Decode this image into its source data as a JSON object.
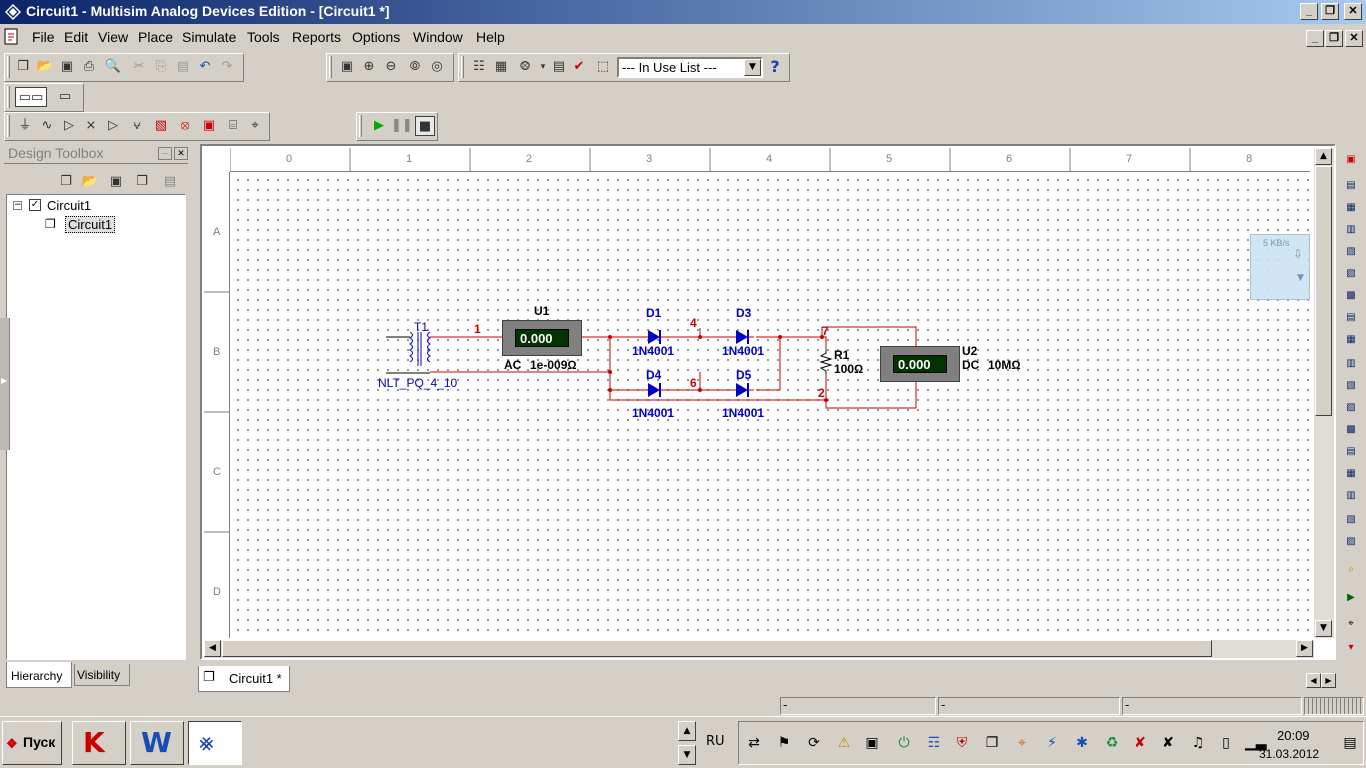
{
  "window": {
    "title": "Circuit1 - Multisim Analog Devices Edition - [Circuit1 *]"
  },
  "menu": [
    "File",
    "Edit",
    "View",
    "Place",
    "Simulate",
    "Tools",
    "Reports",
    "Options",
    "Window",
    "Help"
  ],
  "toolbar": {
    "in_use_list": "--- In Use List ---",
    "help_icon": "?"
  },
  "toolbox": {
    "title": "Design Toolbox",
    "tree": {
      "root": "Circuit1",
      "child": "Circuit1"
    },
    "tabs": [
      "Hierarchy",
      "Visibility"
    ]
  },
  "ruler": {
    "columns": [
      "0",
      "1",
      "2",
      "3",
      "4",
      "5",
      "6",
      "7",
      "8"
    ],
    "rows": [
      "A",
      "B",
      "C",
      "D"
    ]
  },
  "schematic": {
    "transformer": {
      "ref": "T1",
      "model": "NLT_PQ_4_10"
    },
    "meter_u1": {
      "ref": "U1",
      "reading": "0.000",
      "mode": "AC",
      "param": "1e-009Ω"
    },
    "meter_u2": {
      "ref": "U2",
      "reading": "0.000",
      "mode": "DC",
      "param": "10MΩ"
    },
    "diodes": [
      {
        "ref": "D1",
        "model": "1N4001"
      },
      {
        "ref": "D3",
        "model": "1N4001"
      },
      {
        "ref": "D4",
        "model": "1N4001"
      },
      {
        "ref": "D5",
        "model": "1N4001"
      }
    ],
    "resistor": {
      "ref": "R1",
      "value": "100Ω"
    },
    "nets": [
      "1",
      "4",
      "6",
      "7",
      "2"
    ]
  },
  "speed_widget": {
    "label": "5 KB/s"
  },
  "document_tab": "Circuit1 *",
  "statusbar": {
    "cells": [
      "-",
      "-",
      "-"
    ]
  },
  "taskbar": {
    "start_label": "Пуск",
    "language": "RU",
    "time": "20:09",
    "date": "31.03.2012"
  },
  "colors": {
    "titlebar_start": "#0a246a",
    "wire": "#cc0000",
    "component": "#0000cc",
    "meter_display": "#003300",
    "meter_text": "#ffffff"
  }
}
